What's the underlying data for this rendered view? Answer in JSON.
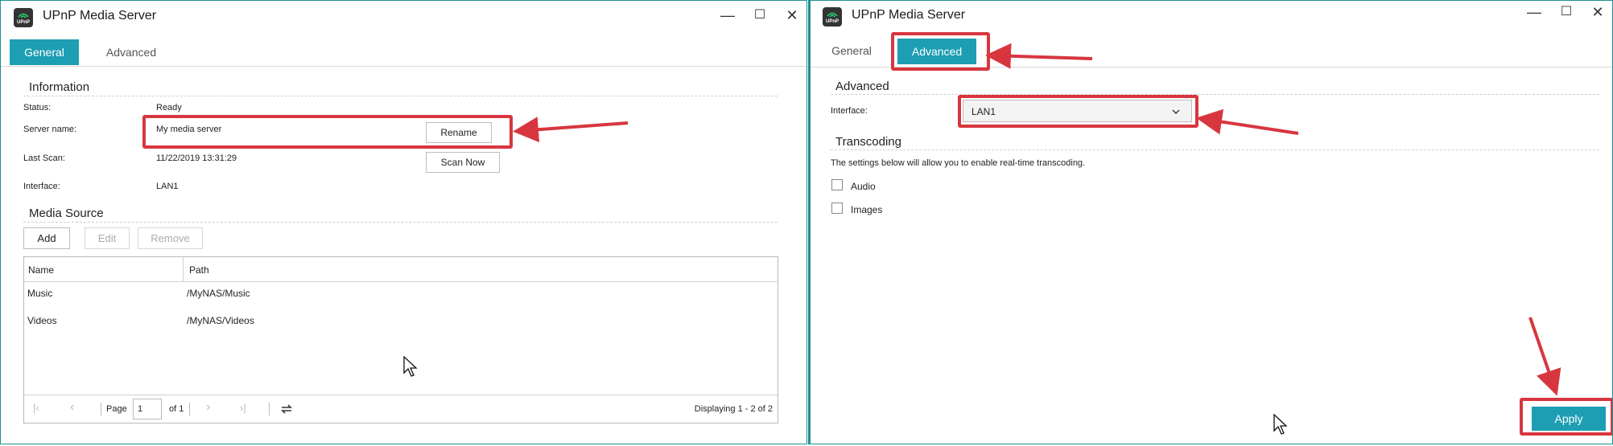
{
  "colors": {
    "accent": "#1e9eb2",
    "annotation": "#d8363f",
    "window_border": "#1e8f93"
  },
  "app_icon_label": "UPnP",
  "left_window": {
    "title": "UPnP Media Server",
    "controls": {
      "minimize": "—",
      "maximize": "☐",
      "close": "✕"
    },
    "tabs": [
      {
        "label": "General",
        "active": true
      },
      {
        "label": "Advanced",
        "active": false
      }
    ],
    "information": {
      "heading": "Information",
      "status_label": "Status:",
      "status_value": "Ready",
      "server_name_label": "Server name:",
      "server_name_value": "My media server",
      "rename_label": "Rename",
      "last_scan_label": "Last Scan:",
      "last_scan_value": "11/22/2019 13:31:29",
      "scan_now_label": "Scan Now",
      "interface_label": "Interface:",
      "interface_value": "LAN1"
    },
    "media_source": {
      "heading": "Media Source",
      "buttons": {
        "add": "Add",
        "edit": "Edit",
        "remove": "Remove"
      },
      "columns": {
        "name": "Name",
        "path": "Path"
      },
      "rows": [
        {
          "name": "Music",
          "path": "/MyNAS/Music"
        },
        {
          "name": "Videos",
          "path": "/MyNAS/Videos"
        }
      ],
      "pager": {
        "page_label": "Page",
        "page_value": "1",
        "of_label": "of 1",
        "displaying": "Displaying 1 - 2 of 2"
      }
    }
  },
  "right_window": {
    "title": "UPnP Media Server",
    "controls": {
      "minimize": "—",
      "maximize": "☐",
      "close": "✕"
    },
    "tabs": [
      {
        "label": "General",
        "active": false
      },
      {
        "label": "Advanced",
        "active": true
      }
    ],
    "advanced": {
      "heading": "Advanced",
      "interface_label": "Interface:",
      "interface_value": "LAN1"
    },
    "transcoding": {
      "heading": "Transcoding",
      "description": "The settings below will allow you to enable real-time transcoding.",
      "options": [
        {
          "label": "Audio",
          "checked": false
        },
        {
          "label": "Images",
          "checked": false
        }
      ]
    },
    "apply_label": "Apply"
  }
}
